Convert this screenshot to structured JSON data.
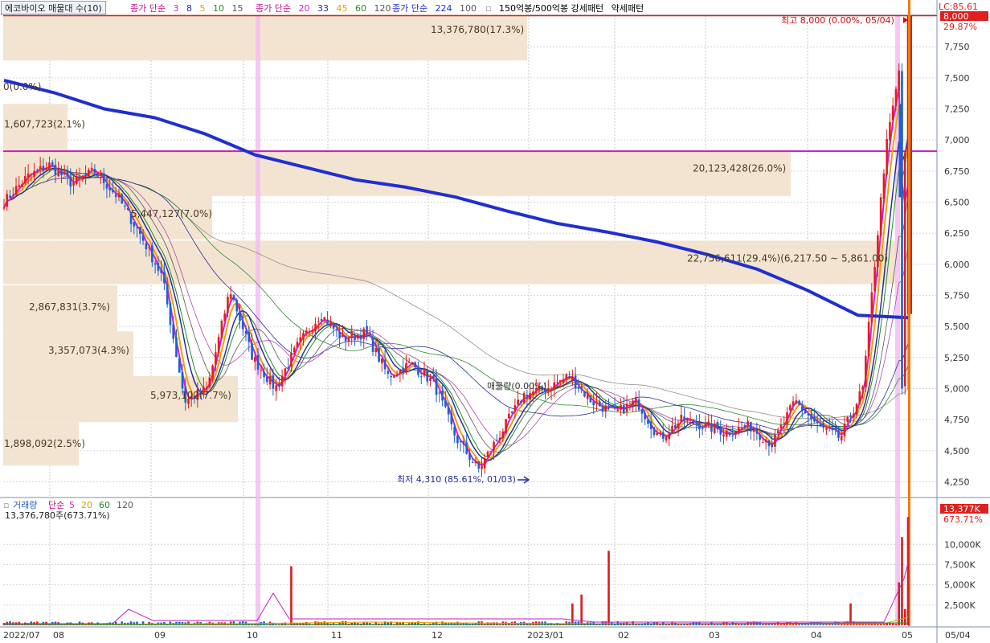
{
  "header": {
    "stock_tab": "에코바이오 매물대 수(10)",
    "ma_groups": [
      {
        "label": "종가 단순",
        "periods": [
          "3",
          "8",
          "5",
          "10",
          "15"
        ],
        "colors": [
          "#d41fd4",
          "#2b2b99",
          "#f0a000",
          "#1f8f1f",
          "#555555"
        ]
      },
      {
        "label": "종가 단순",
        "periods": [
          "20",
          "33",
          "45",
          "60",
          "120"
        ],
        "colors": [
          "#d41fd4",
          "#2b2b99",
          "#e0a000",
          "#1f8f1f",
          "#555555"
        ]
      },
      {
        "label": "종가 단순",
        "periods": [
          "224",
          "100"
        ],
        "colors": [
          "#1f2fd0",
          "#555555"
        ]
      }
    ],
    "pattern_label": "150억봉/500억봉 강세패턴",
    "weak_label": "약세패턴",
    "lc_label": "LC:85.61"
  },
  "price_axis": {
    "ticks": [
      "7,750",
      "7,500",
      "7,250",
      "7,000",
      "6,750",
      "6,500",
      "6,250",
      "6,000",
      "5,750",
      "5,500",
      "5,250",
      "5,000",
      "4,750",
      "4,500",
      "4,250"
    ],
    "current_price": "8,000",
    "current_pct": "29.87%"
  },
  "volume_axis": {
    "ticks": [
      "10,000K",
      "7,500K",
      "5,000K",
      "2,500K"
    ],
    "current_volume": "13,377K",
    "current_pct": "673.71%"
  },
  "volume_panel": {
    "title": "거래량",
    "ma_label": "단순",
    "ma_periods": [
      "5",
      "20",
      "60",
      "120"
    ],
    "ma_colors": [
      "#d41fd4",
      "#e0a000",
      "#1f8f1f",
      "#555555"
    ],
    "last_volume": "13,376,780주(673.71%)"
  },
  "x_axis": {
    "labels": [
      "2022/07",
      "08",
      "09",
      "10",
      "11",
      "12",
      "2023/01",
      "02",
      "03",
      "04",
      "05",
      "05/04"
    ]
  },
  "annotations": {
    "high": "최고 8,000 (0.00%, 05/04)",
    "low": "최저 4,310 (85.61%, 01/03)",
    "zero": "0(0.0%)",
    "mid_text": "매물량(0.00%)"
  },
  "chart_data": {
    "type": "candlestick_with_volume_profile",
    "title": "에코바이오 매물대 수(10)",
    "price_range": [
      4130,
      8010
    ],
    "volume_range": [
      0,
      13500
    ],
    "volume_unit": "K",
    "x_range": [
      "2022-07",
      "2023-05-04"
    ],
    "volume_profile": [
      {
        "label": "13,376,780(17.3%)"
      },
      {
        "label": "1,607,723(2.1%)"
      },
      {
        "label": "20,123,428(26.0%)"
      },
      {
        "label": "5,447,127(7.0%)"
      },
      {
        "label": "22,756,611(29.4%)(6,217.50 ~ 5,861.00)"
      },
      {
        "label": "2,867,831(3.7%)"
      },
      {
        "label": "3,357,073(4.3%)"
      },
      {
        "label": "5,973,102(7.7%)"
      },
      {
        "label": "1,898,092(2.5%)"
      }
    ],
    "ma224_series": [
      7480,
      7380,
      7250,
      7180,
      7050,
      6880,
      6780,
      6680,
      6620,
      6540,
      6430,
      6330,
      6260,
      6180,
      6080,
      5960,
      5790,
      5590,
      5570
    ],
    "close_anchors": [
      6500,
      6700,
      6800,
      6650,
      6750,
      6550,
      6250,
      5900,
      4900,
      5000,
      5800,
      5250,
      5000,
      5350,
      5600,
      5400,
      5450,
      5100,
      5200,
      5050,
      4600,
      4350,
      4650,
      4950,
      5000,
      5100,
      4900,
      4800,
      4900,
      4600,
      4750,
      4700,
      4650,
      4700,
      4550,
      4900,
      4700,
      4600,
      5000,
      6900,
      8000
    ],
    "high_price": 8000,
    "low_price": 4310,
    "current_volume_k": 13377
  }
}
